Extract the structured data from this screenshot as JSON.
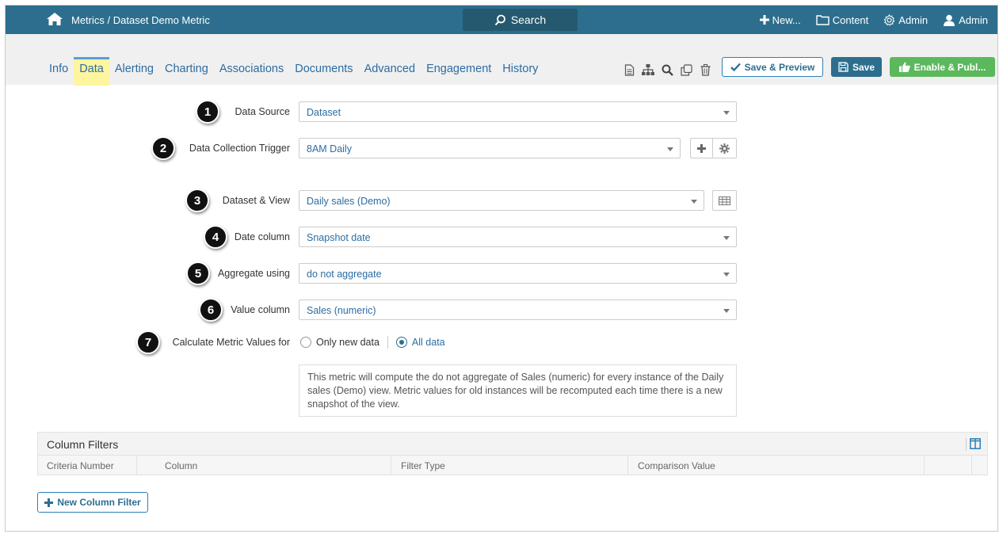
{
  "topbar": {
    "breadcrumb_root": "Metrics",
    "breadcrumb_sep": " / ",
    "breadcrumb_current": "Dataset Demo Metric",
    "search_label": "Search",
    "new_label": "New...",
    "content_label": "Content",
    "admin_settings_label": "Admin",
    "user_label": "Admin"
  },
  "tabs": [
    {
      "label": "Info",
      "active": false
    },
    {
      "label": "Data",
      "active": true
    },
    {
      "label": "Alerting",
      "active": false
    },
    {
      "label": "Charting",
      "active": false
    },
    {
      "label": "Associations",
      "active": false
    },
    {
      "label": "Documents",
      "active": false
    },
    {
      "label": "Advanced",
      "active": false
    },
    {
      "label": "Engagement",
      "active": false
    },
    {
      "label": "History",
      "active": false
    }
  ],
  "toolbar": {
    "save_preview_label": "Save & Preview",
    "save_label": "Save",
    "enable_label": "Enable & Publ..."
  },
  "form": {
    "data_source": {
      "badge": "1",
      "label": "Data Source",
      "value": "Dataset"
    },
    "trigger": {
      "badge": "2",
      "label": "Data Collection Trigger",
      "value": "8AM Daily"
    },
    "dataset_view": {
      "badge": "3",
      "label": "Dataset & View",
      "value": "Daily sales (Demo)"
    },
    "date_column": {
      "badge": "4",
      "label": "Date column",
      "value": "Snapshot date"
    },
    "aggregate": {
      "badge": "5",
      "label": "Aggregate using",
      "value": "do not aggregate"
    },
    "value_column": {
      "badge": "6",
      "label": "Value column",
      "value": "Sales (numeric)"
    },
    "calc": {
      "badge": "7",
      "label": "Calculate Metric Values for",
      "option_new": "Only new data",
      "option_all": "All data",
      "selected": "All data"
    },
    "info_text": "This metric will compute the do not aggregate of Sales (numeric) for every instance of the Daily sales (Demo) view. Metric values for old instances will be recomputed each time there is a new snapshot of the view."
  },
  "column_filters": {
    "title": "Column Filters",
    "columns": [
      "Criteria Number",
      "Column",
      "Filter Type",
      "Comparison Value"
    ],
    "new_button_label": "New Column Filter"
  },
  "colors": {
    "header": "#2d6e8e",
    "link": "#2b6ca3",
    "active_tab_bg": "#fdf59f",
    "enable_green": "#5cb85c"
  }
}
